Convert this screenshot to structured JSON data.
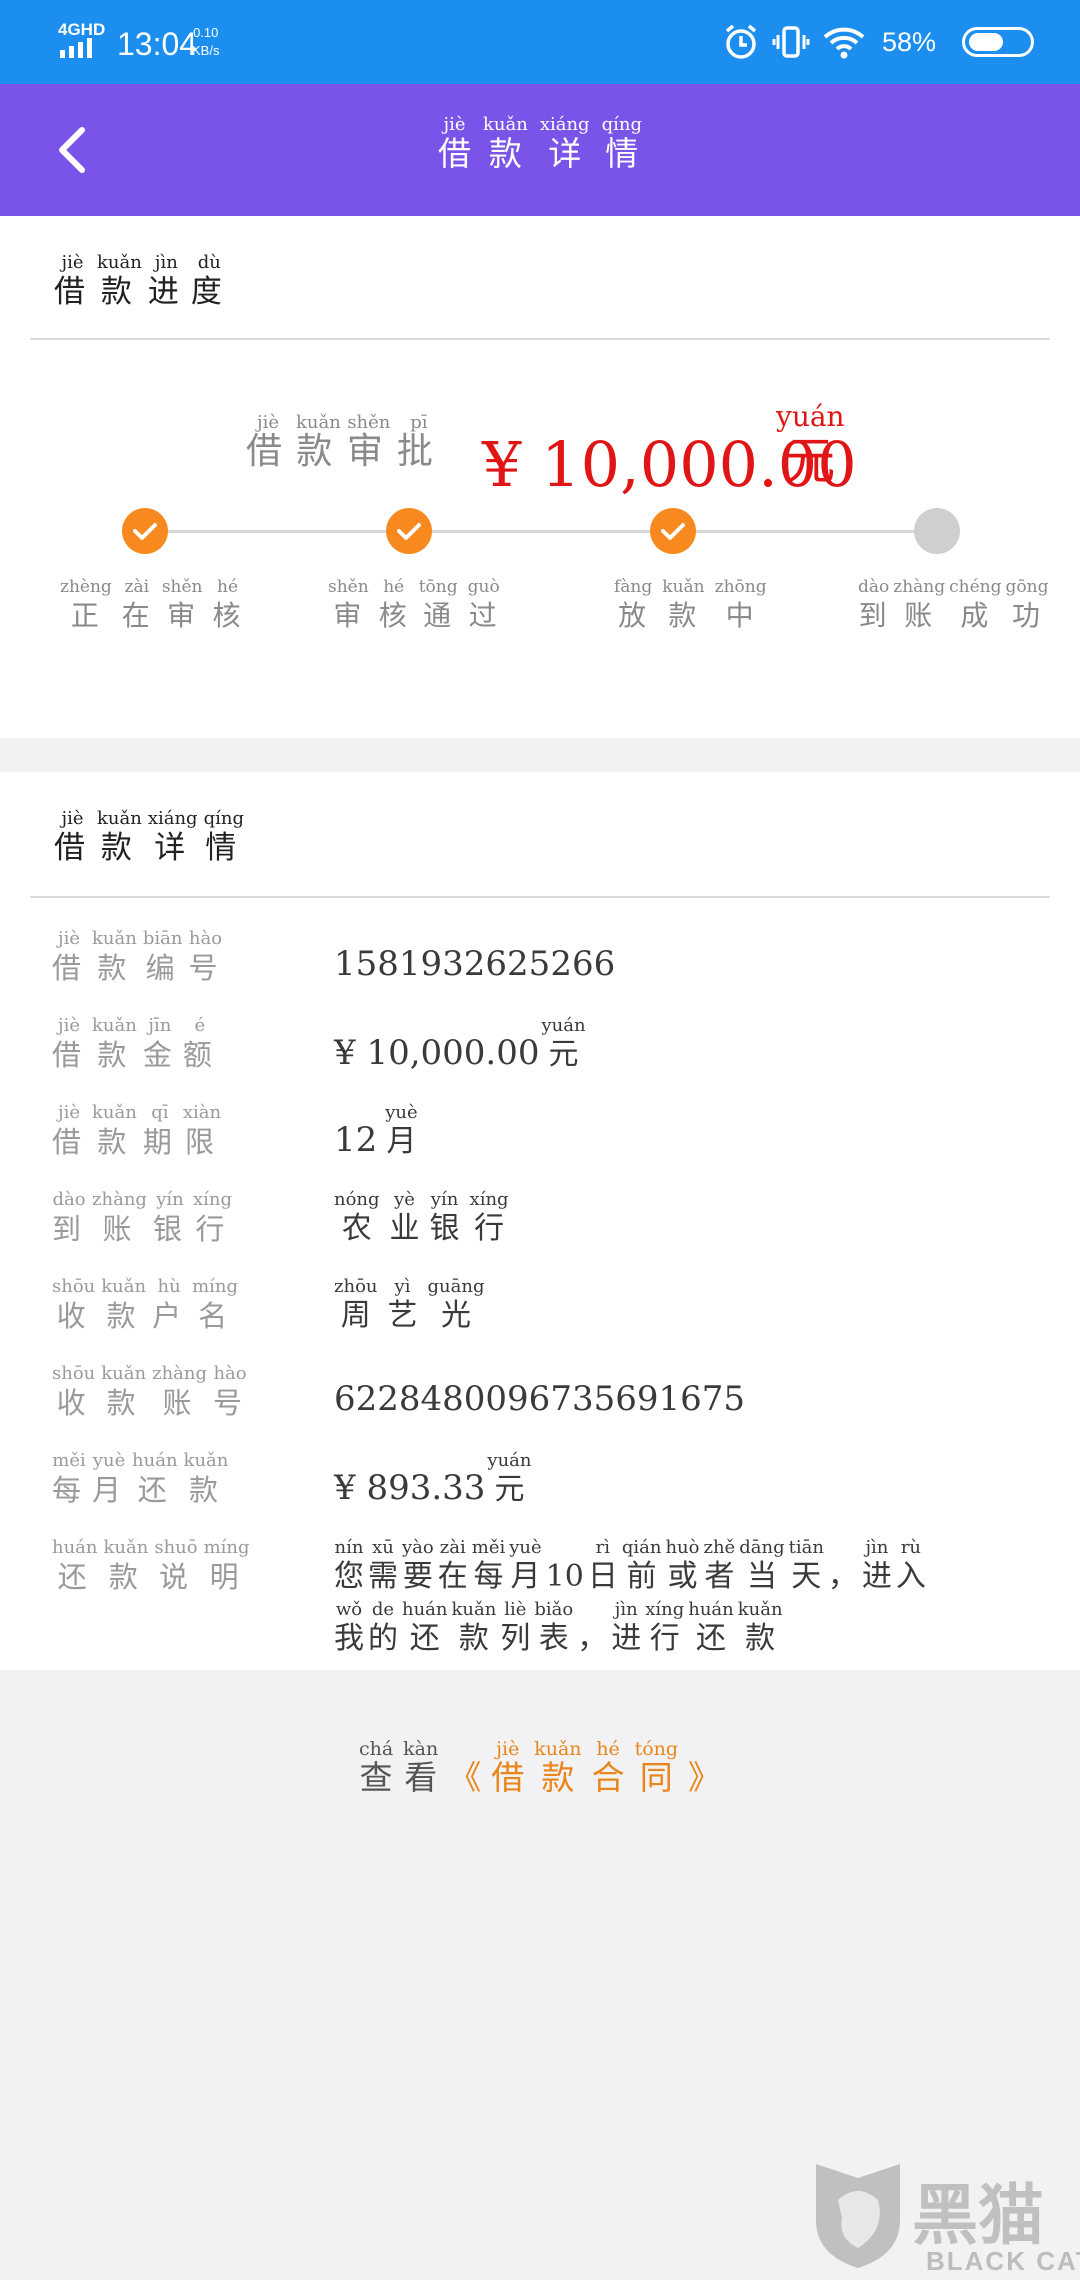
{
  "status_bar": {
    "network": "4GHD",
    "time": "13:04",
    "speed_value": "0.10",
    "speed_unit": "KB/s",
    "battery": "58%"
  },
  "header": {
    "title_pinyin": [
      "jiè",
      "kuǎn",
      "xiáng",
      "qíng"
    ],
    "title_chars": [
      "借",
      "款",
      "详",
      "情"
    ]
  },
  "progress_card": {
    "title_pinyin": [
      "jiè",
      "kuǎn",
      "jìn",
      "dù"
    ],
    "title_chars": [
      "借",
      "款",
      "进",
      "度"
    ],
    "approval_pinyin": [
      "jiè",
      "kuǎn",
      "shěn",
      "pī"
    ],
    "approval_chars": [
      "借",
      "款",
      "审",
      "批"
    ],
    "amount": "¥ 10,000.00",
    "amount_unit_pinyin": "yuán",
    "amount_unit": "元",
    "steps": [
      {
        "pinyin": [
          "zhèng",
          "zài",
          "shěn",
          "hé"
        ],
        "chars": [
          "正",
          "在",
          "审",
          "核"
        ],
        "status": "done"
      },
      {
        "pinyin": [
          "shěn",
          "hé",
          "tōng",
          "guò"
        ],
        "chars": [
          "审",
          "核",
          "通",
          "过"
        ],
        "status": "done"
      },
      {
        "pinyin": [
          "fàng",
          "kuǎn",
          "zhōng"
        ],
        "chars": [
          "放",
          "款",
          "中"
        ],
        "status": "done"
      },
      {
        "pinyin": [
          "dào",
          "zhàng",
          "chéng",
          "gōng"
        ],
        "chars": [
          "到",
          "账",
          "成",
          "功"
        ],
        "status": "pending"
      }
    ],
    "colors": {
      "done": "#f7891e",
      "pending": "#cfcfcf",
      "amount": "#e01616"
    }
  },
  "detail_card": {
    "title_pinyin": [
      "jiè",
      "kuǎn",
      "xiáng",
      "qíng"
    ],
    "title_chars": [
      "借",
      "款",
      "详",
      "情"
    ],
    "rows": [
      {
        "label_pinyin": [
          "jiè",
          "kuǎn",
          "biān",
          "hào"
        ],
        "label_chars": [
          "借",
          "款",
          "编",
          "号"
        ],
        "value": "1581932625266"
      },
      {
        "label_pinyin": [
          "jiè",
          "kuǎn",
          "jīn",
          "é"
        ],
        "label_chars": [
          "借",
          "款",
          "金",
          "额"
        ],
        "value": "¥ 10,000.00",
        "unit_pinyin": "yuán",
        "unit": "元"
      },
      {
        "label_pinyin": [
          "jiè",
          "kuǎn",
          "qī",
          "xiàn"
        ],
        "label_chars": [
          "借",
          "款",
          "期",
          "限"
        ],
        "value": "12",
        "unit_pinyin": "yuè",
        "unit": "月"
      },
      {
        "label_pinyin": [
          "dào",
          "zhàng",
          "yín",
          "xíng"
        ],
        "label_chars": [
          "到",
          "账",
          "银",
          "行"
        ],
        "value_pinyin": [
          "nóng",
          "yè",
          "yín",
          "xíng"
        ],
        "value_chars": [
          "农",
          "业",
          "银",
          "行"
        ]
      },
      {
        "label_pinyin": [
          "shōu",
          "kuǎn",
          "hù",
          "míng"
        ],
        "label_chars": [
          "收",
          "款",
          "户",
          "名"
        ],
        "value_pinyin": [
          "zhōu",
          "yì",
          "guāng"
        ],
        "value_chars": [
          "周",
          "艺",
          "光"
        ]
      },
      {
        "label_pinyin": [
          "shōu",
          "kuǎn",
          "zhàng",
          "hào"
        ],
        "label_chars": [
          "收",
          "款",
          "账",
          "号"
        ],
        "value": "6228480096735691675"
      },
      {
        "label_pinyin": [
          "měi",
          "yuè",
          "huán",
          "kuǎn"
        ],
        "label_chars": [
          "每",
          "月",
          "还",
          "款"
        ],
        "value": "¥ 893.33",
        "unit_pinyin": "yuán",
        "unit": "元"
      }
    ],
    "note_label_pinyin": [
      "huán",
      "kuǎn",
      "shuō",
      "míng"
    ],
    "note_label_chars": [
      "还",
      "款",
      "说",
      "明"
    ],
    "note_line1_pinyin": [
      "nín",
      "xū",
      "yào",
      "zài",
      "měi",
      "yuè",
      "",
      "rì",
      "qián",
      "huò",
      "zhě",
      "dāng",
      "tiān",
      "",
      "jìn",
      "rù"
    ],
    "note_line1_chars": [
      "您",
      "需",
      "要",
      "在",
      "每",
      "月",
      "10",
      "日",
      "前",
      "或",
      "者",
      "当",
      "天",
      "，",
      "进",
      "入"
    ],
    "note_line2_pinyin": [
      "wǒ",
      "de",
      "huán",
      "kuǎn",
      "liè",
      "biǎo",
      "",
      "jìn",
      "xíng",
      "huán",
      "kuǎn"
    ],
    "note_line2_chars": [
      "我",
      "的",
      "还",
      "款",
      "列",
      "表",
      "，",
      "进",
      "行",
      "还",
      "款"
    ]
  },
  "contract_link": {
    "prefix_pinyin": [
      "chá",
      "kàn"
    ],
    "prefix_chars": [
      "查",
      "看"
    ],
    "open_bracket": "《",
    "name_pinyin": [
      "jiè",
      "kuǎn",
      "hé",
      "tóng"
    ],
    "name_chars": [
      "借",
      "款",
      "合",
      "同"
    ],
    "close_bracket": "》"
  },
  "watermark": {
    "logo_text": "黑猫",
    "brand": "BLACK CAT"
  }
}
